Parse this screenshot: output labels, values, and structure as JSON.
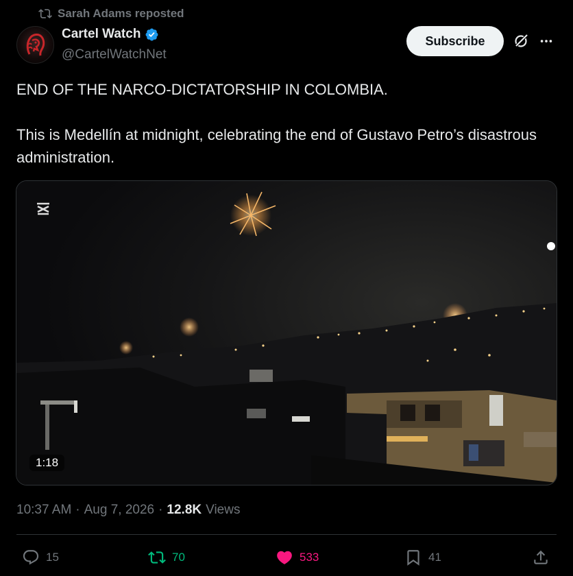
{
  "repost": {
    "text": "Sarah Adams reposted",
    "icon": "repost-icon"
  },
  "author": {
    "name": "Cartel Watch",
    "handle": "@CartelWatchNet",
    "verified_color": "#1d9bf0"
  },
  "header_actions": {
    "subscribe_label": "Subscribe",
    "grok_icon": "grok-icon",
    "more_icon": "more-icon"
  },
  "tweet": {
    "line1": "END OF THE NARCO-DICTATORSHIP IN COLOMBIA.",
    "line2": "This is Medellín at midnight, celebrating the end of Gustavo Petro’s disastrous administration."
  },
  "media": {
    "type": "video",
    "duration": "1:18",
    "watermark_icon": "capcut-icon"
  },
  "meta": {
    "time": "10:37 AM",
    "sep1": "·",
    "date": "Aug 7, 2026",
    "sep2": "·",
    "views_count": "12.8K",
    "views_label": "Views"
  },
  "actions": {
    "replies": "15",
    "reposts": "70",
    "likes": "533",
    "bookmarks": "41"
  },
  "colors": {
    "background": "#000000",
    "text": "#e7e9ea",
    "muted": "#71767b",
    "retweet": "#00ba7c",
    "like": "#f91880",
    "verified": "#1d9bf0"
  }
}
